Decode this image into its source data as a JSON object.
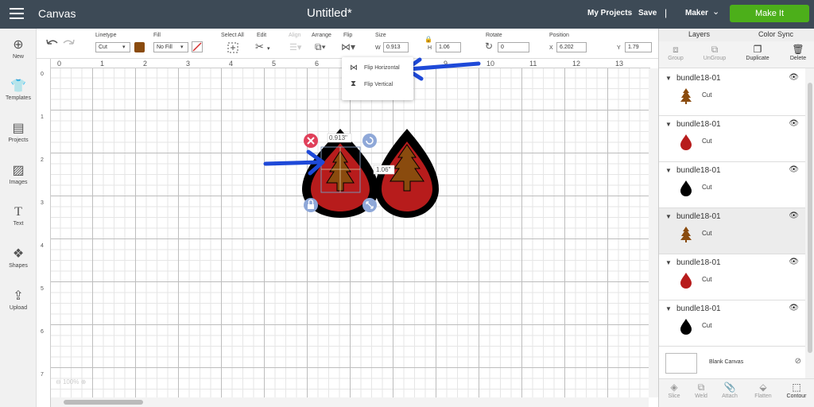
{
  "topbar": {
    "app_name": "Canvas",
    "doc_title": "Untitled*",
    "my_projects": "My Projects",
    "save": "Save",
    "separator": "|",
    "machine": "Maker",
    "make_it": "Make It"
  },
  "nav": [
    {
      "label": "New",
      "icon": "plus-circle-icon"
    },
    {
      "label": "Templates",
      "icon": "shirt-icon"
    },
    {
      "label": "Projects",
      "icon": "book-icon"
    },
    {
      "label": "Images",
      "icon": "image-icon"
    },
    {
      "label": "Text",
      "icon": "text-icon"
    },
    {
      "label": "Shapes",
      "icon": "shapes-icon"
    },
    {
      "label": "Upload",
      "icon": "upload-icon"
    }
  ],
  "toolbar": {
    "linetype_label": "Linetype",
    "linetype_value": "Cut",
    "linetype_color": "#8a4b0e",
    "fill_label": "Fill",
    "fill_value": "No Fill",
    "select_all": "Select All",
    "edit": "Edit",
    "align": "Align",
    "arrange": "Arrange",
    "flip": "Flip",
    "size_label": "Size",
    "w_label": "W",
    "w_value": "0.913",
    "h_label": "H",
    "h_value": "1.06",
    "rotate_label": "Rotate",
    "rotate_value": "0",
    "position_label": "Position",
    "x_label": "X",
    "x_value": "6.202",
    "y_label": "Y",
    "y_value": "1.79"
  },
  "flip_menu": {
    "flip_horizontal": "Flip Horizontal",
    "flip_vertical": "Flip Vertical"
  },
  "ruler": {
    "top": [
      "0",
      "1",
      "2",
      "3",
      "4",
      "5",
      "6",
      "7",
      "8",
      "9",
      "10",
      "11",
      "12",
      "13"
    ],
    "left": [
      "0",
      "1",
      "2",
      "3",
      "4",
      "5",
      "6",
      "7"
    ]
  },
  "canvas": {
    "width_readout": "0.913\"",
    "height_readout": "1.06\"",
    "zoom": "100%"
  },
  "panel": {
    "tab_layers": "Layers",
    "tab_color_sync": "Color Sync",
    "actions": [
      "Group",
      "UnGroup",
      "Duplicate",
      "Delete"
    ],
    "layers": [
      {
        "name": "bundle18-01",
        "op": "Cut",
        "shape": "tree",
        "color": "#8a4b0e"
      },
      {
        "name": "bundle18-01",
        "op": "Cut",
        "shape": "drop",
        "color": "#b71c1c"
      },
      {
        "name": "bundle18-01",
        "op": "Cut",
        "shape": "drop",
        "color": "#000000"
      },
      {
        "name": "bundle18-01",
        "op": "Cut",
        "shape": "tree",
        "color": "#8a4b0e"
      },
      {
        "name": "bundle18-01",
        "op": "Cut",
        "shape": "drop",
        "color": "#b71c1c"
      },
      {
        "name": "bundle18-01",
        "op": "Cut",
        "shape": "drop",
        "color": "#000000"
      }
    ],
    "blank_canvas": "Blank Canvas",
    "bottom_actions": [
      "Slice",
      "Weld",
      "Attach",
      "Flatten",
      "Contour"
    ]
  },
  "colors": {
    "accent_green": "#4caf1a",
    "topbar_bg": "#3d4a56",
    "annotation_arrow": "#1e49d8",
    "earring_red": "#b71c1c",
    "tree_brown": "#8a4b0e"
  }
}
